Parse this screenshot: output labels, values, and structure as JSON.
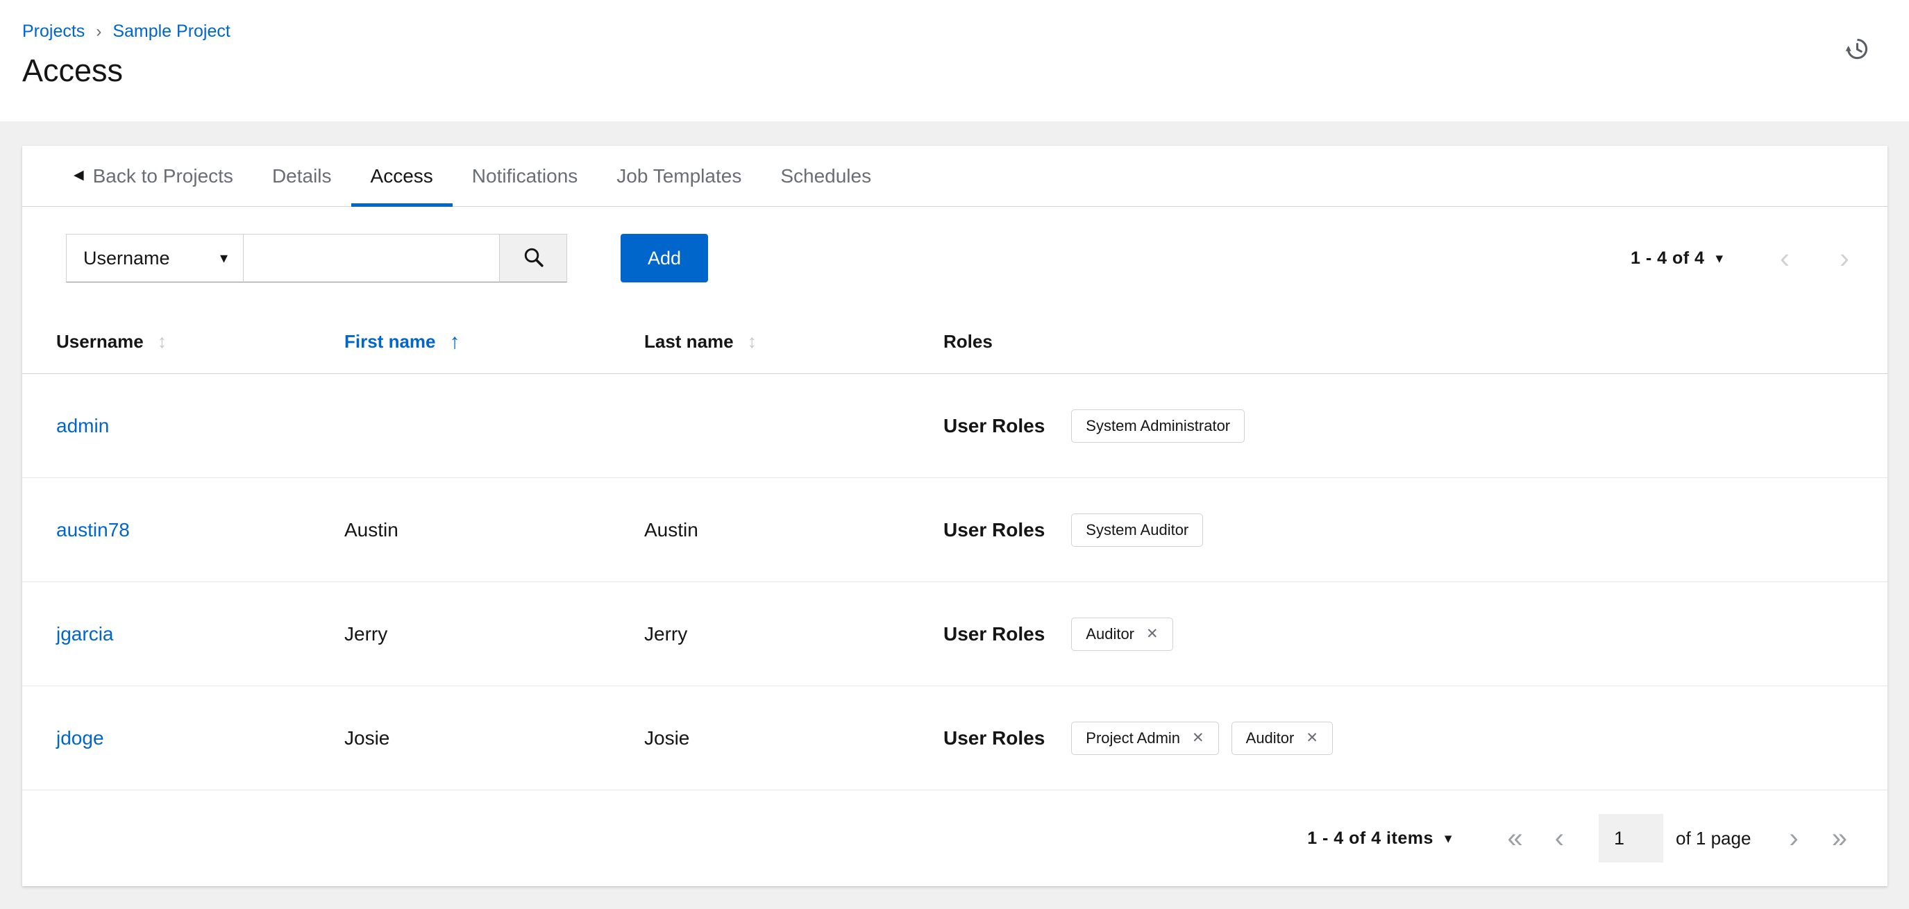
{
  "breadcrumb": {
    "items": [
      {
        "label": "Projects"
      },
      {
        "label": "Sample Project"
      }
    ]
  },
  "page": {
    "title": "Access"
  },
  "tabs": {
    "back_label": "Back to Projects",
    "items": [
      {
        "label": "Details"
      },
      {
        "label": "Access"
      },
      {
        "label": "Notifications"
      },
      {
        "label": "Job Templates"
      },
      {
        "label": "Schedules"
      }
    ],
    "active": "Access"
  },
  "toolbar": {
    "filter": {
      "selected": "Username"
    },
    "search": {
      "value": "",
      "placeholder": ""
    },
    "add_label": "Add",
    "pagination": {
      "summary": "1 - 4 of 4"
    }
  },
  "table": {
    "columns": [
      {
        "label": "Username",
        "sort": "sortable"
      },
      {
        "label": "First name",
        "sort": "ascending"
      },
      {
        "label": "Last name",
        "sort": "sortable"
      },
      {
        "label": "Roles",
        "sort": "none"
      }
    ],
    "rows": [
      {
        "username": "admin",
        "first_name": "",
        "last_name": "",
        "roles_label": "User Roles",
        "chips": [
          {
            "label": "System Administrator",
            "removable": false
          }
        ]
      },
      {
        "username": "austin78",
        "first_name": "Austin",
        "last_name": "Austin",
        "roles_label": "User Roles",
        "chips": [
          {
            "label": "System Auditor",
            "removable": false
          }
        ]
      },
      {
        "username": "jgarcia",
        "first_name": "Jerry",
        "last_name": "Jerry",
        "roles_label": "User Roles",
        "chips": [
          {
            "label": "Auditor",
            "removable": true
          }
        ]
      },
      {
        "username": "jdoge",
        "first_name": "Josie",
        "last_name": "Josie",
        "roles_label": "User Roles",
        "chips": [
          {
            "label": "Project Admin",
            "removable": true
          },
          {
            "label": "Auditor",
            "removable": true
          }
        ]
      }
    ]
  },
  "footer": {
    "summary": "1 - 4 of 4 items",
    "current_page": "1",
    "page_count_label": "of 1 page"
  },
  "icons": {
    "breadcrumb_separator": "›",
    "back_arrow": "◀",
    "caret_down": "▾",
    "sort_both": "↕",
    "sort_up": "↑",
    "angle_left": "‹",
    "angle_right": "›",
    "angle_double_left": "«",
    "angle_double_right": "»",
    "close": "✕"
  },
  "colors": {
    "accent": "#0066cc",
    "link": "#0066cc",
    "background": "#f0f0f0",
    "text": "#151515",
    "muted_text": "#6a6e73",
    "border": "#d2d2d2"
  }
}
